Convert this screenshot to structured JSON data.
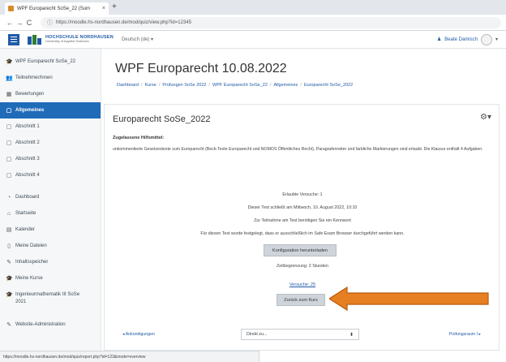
{
  "browser": {
    "tab_title": "WPF Europarecht SoSe_22 (Sum",
    "tab_close": "×",
    "new_tab": "+",
    "back": "←",
    "forward": "→",
    "reload": "C",
    "url": "https://moodle.hs-nordhausen.de/mod/quiz/view.php?id=12345"
  },
  "navbar": {
    "logo_line1": "HOCHSCHULE NORDHAUSEN",
    "logo_line2": "University of Applied Sciences",
    "language": "Deutsch (de) ▾",
    "user_name": "Beate Damisch",
    "colors": {
      "brand": "#1f5aa6",
      "accent_orange": "#e67e22"
    }
  },
  "sidebar": {
    "items": [
      {
        "icon": "graduation-cap-icon",
        "glyph": "🎓",
        "label": "WPF Europarecht SoSe_22"
      },
      {
        "icon": "users-icon",
        "glyph": "👥",
        "label": "Teilnehmer/innen"
      },
      {
        "icon": "table-icon",
        "glyph": "▦",
        "label": "Bewertungen"
      },
      {
        "icon": "folder-icon",
        "glyph": "▢",
        "label": "Allgemeines",
        "active": true
      },
      {
        "icon": "folder-icon",
        "glyph": "▢",
        "label": "Abschnitt 1"
      },
      {
        "icon": "folder-icon",
        "glyph": "▢",
        "label": "Abschnitt 2"
      },
      {
        "icon": "folder-icon",
        "glyph": "▢",
        "label": "Abschnitt 3"
      },
      {
        "icon": "folder-icon",
        "glyph": "▢",
        "label": "Abschnitt 4"
      }
    ],
    "items2": [
      {
        "icon": "dashboard-icon",
        "glyph": "◔",
        "label": "Dashboard"
      },
      {
        "icon": "home-icon",
        "glyph": "⌂",
        "label": "Startseite"
      },
      {
        "icon": "calendar-icon",
        "glyph": "▤",
        "label": "Kalender"
      },
      {
        "icon": "file-icon",
        "glyph": "▯",
        "label": "Meine Dateien"
      },
      {
        "icon": "pencil-icon",
        "glyph": "✎",
        "label": "Inhaltsspeicher"
      },
      {
        "icon": "graduation-cap-icon",
        "glyph": "🎓",
        "label": "Meine Kurse"
      },
      {
        "icon": "graduation-cap-icon",
        "glyph": "🎓",
        "label": "Ingenieurmathematik III SoSe 2021"
      }
    ],
    "admin": {
      "icon": "wrench-icon",
      "glyph": "✎",
      "label": "Website-Administration"
    }
  },
  "header": {
    "title": "WPF Europarecht 10.08.2022",
    "breadcrumb": [
      "Dashboard",
      "Kurse",
      "Prüfungen SoSe 2022",
      "WPF Europarecht SoSe_22",
      "Allgemeines",
      "Europarecht SoSe_2022"
    ],
    "separator": "/"
  },
  "quiz": {
    "title": "Europarecht SoSe_2022",
    "hint_heading": "Zugelassene Hilfsmittel:",
    "description": "unkommentierte Gesetzestexte zum Europarecht (Beck-Texte Europarecht und NOMOS Öffentliches Recht), Paragrafenreiter und farbliche Markierungen sind erlaubt. Die Klausur enthält 4 Aufgaben.",
    "attempts_allowed": "Erlaubte Versuche: 1",
    "closes": "Dieser Test schließt am Mittwoch, 10. August 2022, 10:10",
    "password_needed": "Zur Teilnahme am Test benötigen Sie ein Kennwort",
    "safe_browser": "Für diesen Test wurde festgelegt, dass er ausschließlich im Safe Exam Browser durchgeführt werden kann.",
    "download_config_button": "Konfiguration herunterladen",
    "time_limit": "Zeitbegrenzung: 2 Stunden",
    "attempts_link": "Versuche: 25",
    "back_button": "Zurück zum Kurs",
    "prev_link": "◂ Ankündigungen",
    "jump_to": "Direkt zu...",
    "jump_arrow": "⬍",
    "next_link": "Prüfungsraum I ▸"
  },
  "statusbar": {
    "url": "https://moodle.hs-nordhausen.de/mod/quiz/report.php?id=123&mode=overview"
  }
}
